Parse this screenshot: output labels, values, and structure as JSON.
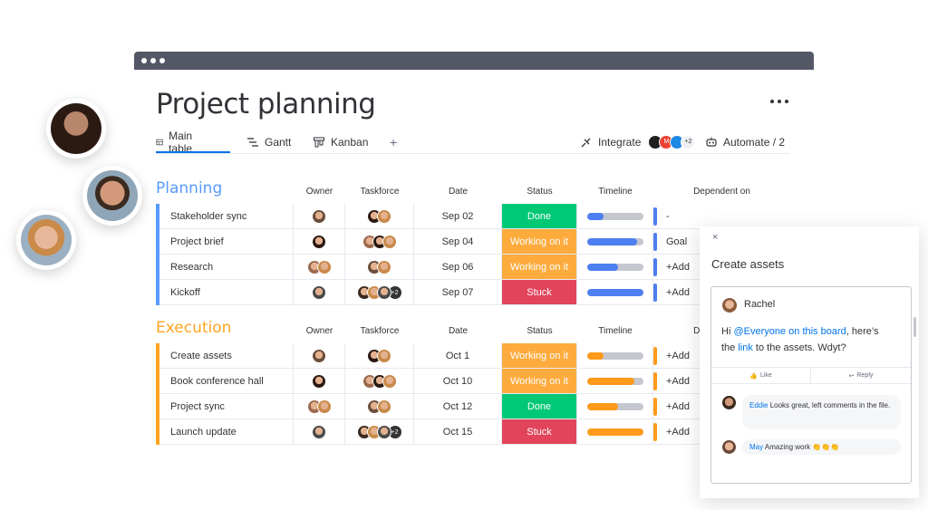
{
  "header": {
    "title": "Project planning",
    "tabs": [
      {
        "label": "Main table"
      },
      {
        "label": "Gantt"
      },
      {
        "label": "Kanban"
      }
    ],
    "add_tab": "+",
    "integrate_label": "Integrate",
    "integrate_badge": "+2",
    "automate_label": "Automate / 2"
  },
  "columns": {
    "owner": "Owner",
    "taskforce": "Taskforce",
    "date": "Date",
    "status": "Status",
    "timeline": "Timeline",
    "dependent": "Dependent on"
  },
  "colors": {
    "done": "#00c875",
    "working": "#fdab3d",
    "stuck": "#e2445c",
    "planning": "#579bfc",
    "execution": "#ffa51f",
    "timeline_planning": "#4d7ff0",
    "timeline_execution": "#ff9a1a"
  },
  "groups": [
    {
      "title": "Planning",
      "color": "#579bfc",
      "rows": [
        {
          "name": "Stakeholder sync",
          "date": "Sep 02",
          "status": "Done",
          "status_color": "#00c875",
          "progress": 0.3,
          "dependent": "-",
          "extra": ""
        },
        {
          "name": "Project brief",
          "date": "Sep 04",
          "status": "Working on it",
          "status_color": "#fdab3d",
          "progress": 0.9,
          "dependent": "Goal",
          "extra": ""
        },
        {
          "name": "Research",
          "date": "Sep 06",
          "status": "Working on it",
          "status_color": "#fdab3d",
          "progress": 0.55,
          "dependent": "+Add",
          "extra": ""
        },
        {
          "name": "Kickoff",
          "date": "Sep 07",
          "status": "Stuck",
          "status_color": "#e2445c",
          "progress": 1.0,
          "dependent": "+Add",
          "extra": "+2"
        }
      ]
    },
    {
      "title": "Execution",
      "color": "#ffa51f",
      "rows": [
        {
          "name": "Create assets",
          "date": "Oct 1",
          "status": "Working on it",
          "status_color": "#fdab3d",
          "progress": 0.3,
          "dependent": "+Add",
          "extra": ""
        },
        {
          "name": "Book conference hall",
          "date": "Oct 10",
          "status": "Working on it",
          "status_color": "#fdab3d",
          "progress": 0.85,
          "dependent": "+Add",
          "extra": ""
        },
        {
          "name": "Project sync",
          "date": "Oct 12",
          "status": "Done",
          "status_color": "#00c875",
          "progress": 0.55,
          "dependent": "+Add",
          "extra": ""
        },
        {
          "name": "Launch update",
          "date": "Oct 15",
          "status": "Stuck",
          "status_color": "#e2445c",
          "progress": 1.0,
          "dependent": "+Add",
          "extra": "+2"
        }
      ]
    }
  ],
  "panel": {
    "close": "×",
    "title": "Create assets",
    "author": "Rachel",
    "msg_hi": "Hi ",
    "msg_mention": "@Everyone on this board",
    "msg_mid": ", here’s",
    "msg_the": "the ",
    "msg_link": "link",
    "msg_end": " to the assets. Wdyt?",
    "like": "Like",
    "reply": "Reply",
    "replies": [
      {
        "name": "Eddie",
        "text": " Looks great, left comments in the file."
      },
      {
        "name": "May",
        "text": " Amazing work 👏👏👏"
      }
    ]
  }
}
